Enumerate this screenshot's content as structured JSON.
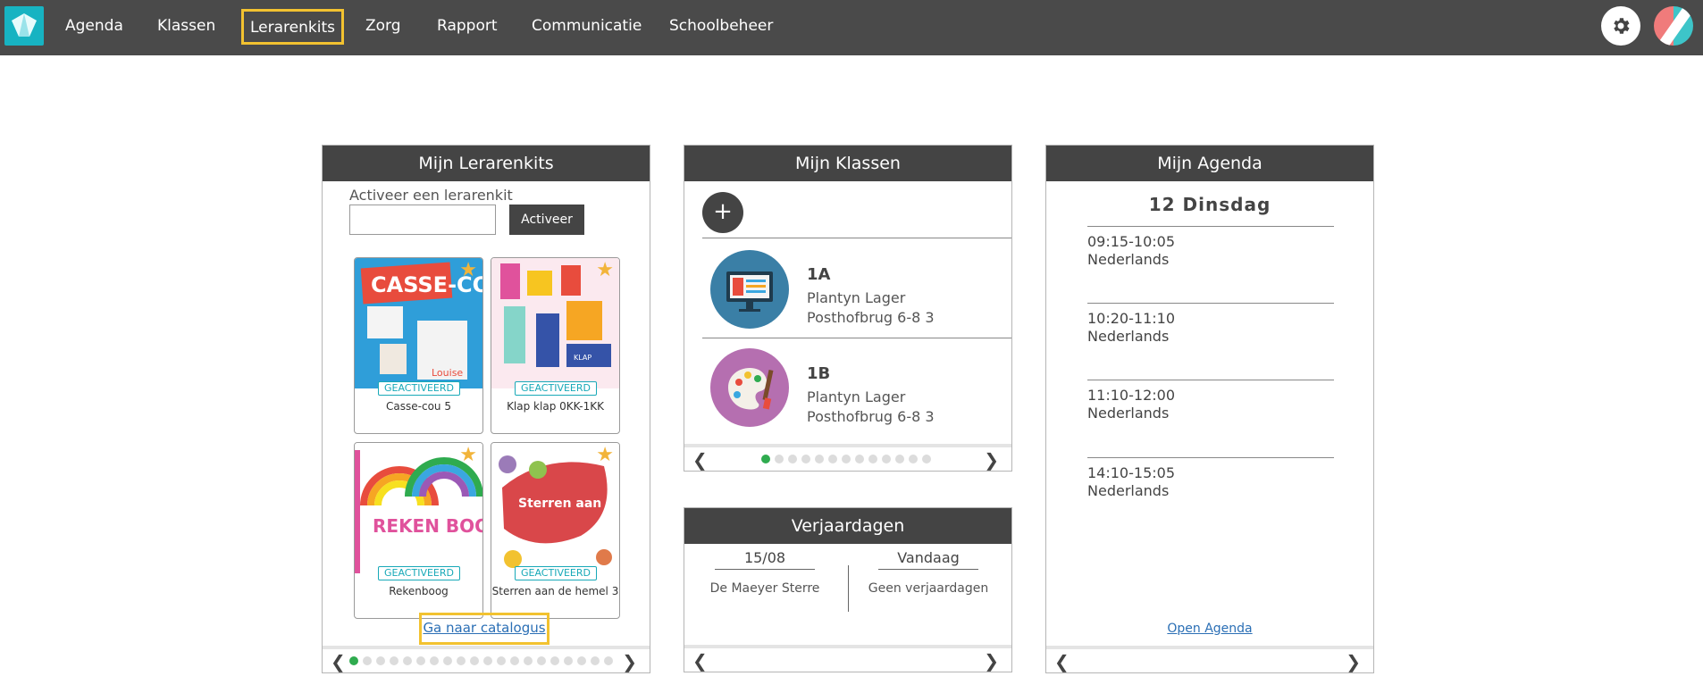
{
  "nav": {
    "items": [
      "Agenda",
      "Klassen",
      "Lerarenkits",
      "Zorg",
      "Rapport",
      "Communicatie",
      "Schoolbeheer"
    ]
  },
  "lerarenkits": {
    "title": "Mijn Lerarenkits",
    "activate_label": "Activeer een lerarenkit",
    "input_value": "",
    "activate_button": "Activeer",
    "kits": [
      {
        "badge": "GEACTIVEERD",
        "title": "Casse-cou 5",
        "cover_text": "CASSE-COU",
        "cover_name": "Louise"
      },
      {
        "badge": "GEACTIVEERD",
        "title": "Klap klap 0KK-1KK",
        "cover_text": "KLAP"
      },
      {
        "badge": "GEACTIVEERD",
        "title": "Rekenboog",
        "cover_text": "REKEN BOOG"
      },
      {
        "badge": "GEACTIVEERD",
        "title": "Sterren aan de hemel 3",
        "cover_text": "Sterren aan de hemel"
      }
    ],
    "catalog_link": "Ga naar catalogus",
    "pager_pages": 20,
    "pager_active": 0
  },
  "klassen": {
    "title": "Mijn Klassen",
    "add_label": "+",
    "classes": [
      {
        "name": "1A",
        "school": "Plantyn Lager",
        "location": "Posthofbrug 6-8 3"
      },
      {
        "name": "1B",
        "school": "Plantyn Lager",
        "location": "Posthofbrug 6-8 3"
      }
    ],
    "pager_pages": 13,
    "pager_active": 0
  },
  "verjaardagen": {
    "title": "Verjaardagen",
    "columns": [
      {
        "head": "15/08",
        "text": "De Maeyer Sterre"
      },
      {
        "head": "Vandaag",
        "text": "Geen verjaardagen"
      }
    ]
  },
  "agenda": {
    "title": "Mijn Agenda",
    "day": "12 Dinsdag",
    "items": [
      {
        "time": "09:15-10:05",
        "subject": "Nederlands"
      },
      {
        "time": "10:20-11:10",
        "subject": "Nederlands"
      },
      {
        "time": "11:10-12:00",
        "subject": "Nederlands"
      },
      {
        "time": "14:10-15:05",
        "subject": "Nederlands"
      }
    ],
    "open_link": "Open Agenda"
  },
  "colors": {
    "topbar": "#4a4a4a",
    "accent_highlight": "#f2c230",
    "badge": "#18a9b8",
    "link": "#2b6fb5",
    "pager_active": "#2fab4f"
  }
}
